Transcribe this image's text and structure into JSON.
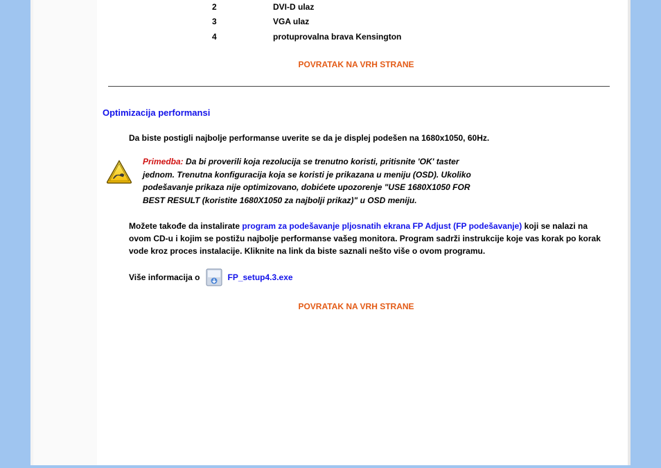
{
  "ports": [
    {
      "num": "2",
      "label": "DVI-D ulaz"
    },
    {
      "num": "3",
      "label": "VGA ulaz"
    },
    {
      "num": "4",
      "label": "protuprovalna brava Kensington"
    }
  ],
  "back_to_top": "POVRATAK NA VRH STRANE",
  "section_title": "Optimizacija performansi",
  "para1": "Da biste postigli najbolje performanse uverite se da je displej podešen na 1680x1050, 60Hz.",
  "note_label": "Primedba:",
  "note_body": " Da bi proverili koja rezolucija se trenutno koristi, pritisnite 'OK' taster jednom. Trenutna konfiguracija koja se koristi je prikazana u meniju (OSD). Ukoliko podešavanje prikaza nije optimizovano, dobićete upozorenje \"USE 1680X1050 FOR BEST RESULT (koristite 1680X1050 za najbolji prikaz)\" u OSD meniju.",
  "para2_pre": "Možete takođe da instalirate ",
  "para2_link": "program za podešavanje pljosnatih ekrana FP Adjust (FP podešavanje)",
  "para2_post": " koji se nalazi na ovom CD-u i kojim se postižu najbolje performanse vašeg monitora. Program sadrži instrukcije koje vas korak po korak vode kroz proces instalacije. Kliknite na link da biste saznali nešto više o ovom programu.",
  "more_info_label": "Više informacija o",
  "file_name": "FP_setup4.3.exe"
}
